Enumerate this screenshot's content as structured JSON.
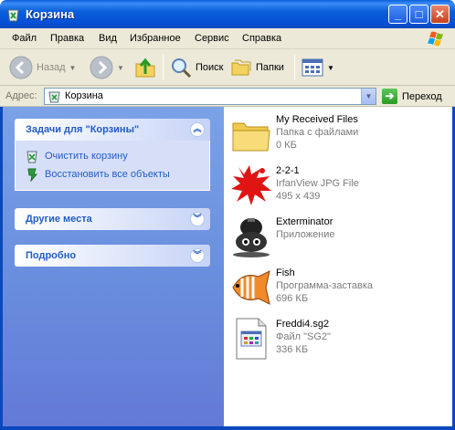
{
  "window": {
    "title": "Корзина"
  },
  "menu": [
    "Файл",
    "Правка",
    "Вид",
    "Избранное",
    "Сервис",
    "Справка"
  ],
  "toolbar": {
    "back_label": "Назад",
    "search_label": "Поиск",
    "folders_label": "Папки"
  },
  "address": {
    "label": "Адрес:",
    "value": "Корзина",
    "go_label": "Переход"
  },
  "tasks_panel": {
    "title": "Задачи для \"Корзины\"",
    "items": [
      "Очистить корзину",
      "Восстановить все объекты"
    ]
  },
  "places_panel": {
    "title": "Другие места"
  },
  "details_panel": {
    "title": "Подробно"
  },
  "files": [
    {
      "name": "My Received Files",
      "line1": "Папка с файлами",
      "line2": "0 КБ",
      "icon": "folder-icon"
    },
    {
      "name": "2-2-1",
      "line1": "IrfanView JPG File",
      "line2": "495 x 439",
      "icon": "irfanview-icon"
    },
    {
      "name": "Exterminator",
      "line1": "Приложение",
      "line2": "",
      "icon": "exterminator-icon"
    },
    {
      "name": "Fish",
      "line1": "Программа-заставка",
      "line2": "696 КБ",
      "icon": "fish-icon"
    },
    {
      "name": "Freddi4.sg2",
      "line1": "Файл \"SG2\"",
      "line2": "336 КБ",
      "icon": "document-icon"
    }
  ],
  "colors": {
    "titlebar": "#0a5fdb",
    "task_link": "#215dc6",
    "left_pane": "#6a8fdf"
  }
}
